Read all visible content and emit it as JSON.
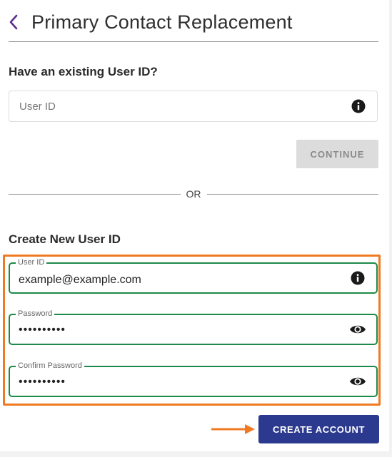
{
  "header": {
    "title": "Primary Contact Replacement",
    "back_icon": "chevron-left-icon",
    "accent": "#5a2d91"
  },
  "existing": {
    "heading": "Have an existing User ID?",
    "user_id_placeholder": "User ID",
    "user_id_value": "",
    "info_icon": "info-icon",
    "continue_label": "CONTINUE",
    "continue_disabled": true
  },
  "divider": {
    "label": "OR"
  },
  "create": {
    "heading": "Create New User ID",
    "fields": [
      {
        "label": "User ID",
        "value": "example@example.com",
        "icon": "info-icon"
      },
      {
        "label": "Password",
        "value": "••••••••••",
        "icon": "eye-icon"
      },
      {
        "label": "Confirm Password",
        "value": "••••••••••",
        "icon": "eye-icon"
      }
    ],
    "submit_label": "CREATE ACCOUNT"
  },
  "colors": {
    "field_border": "#1d8a48",
    "highlight": "#ef7a22",
    "primary_button": "#2b3a8f",
    "disabled_button": "#dcdcdc"
  }
}
